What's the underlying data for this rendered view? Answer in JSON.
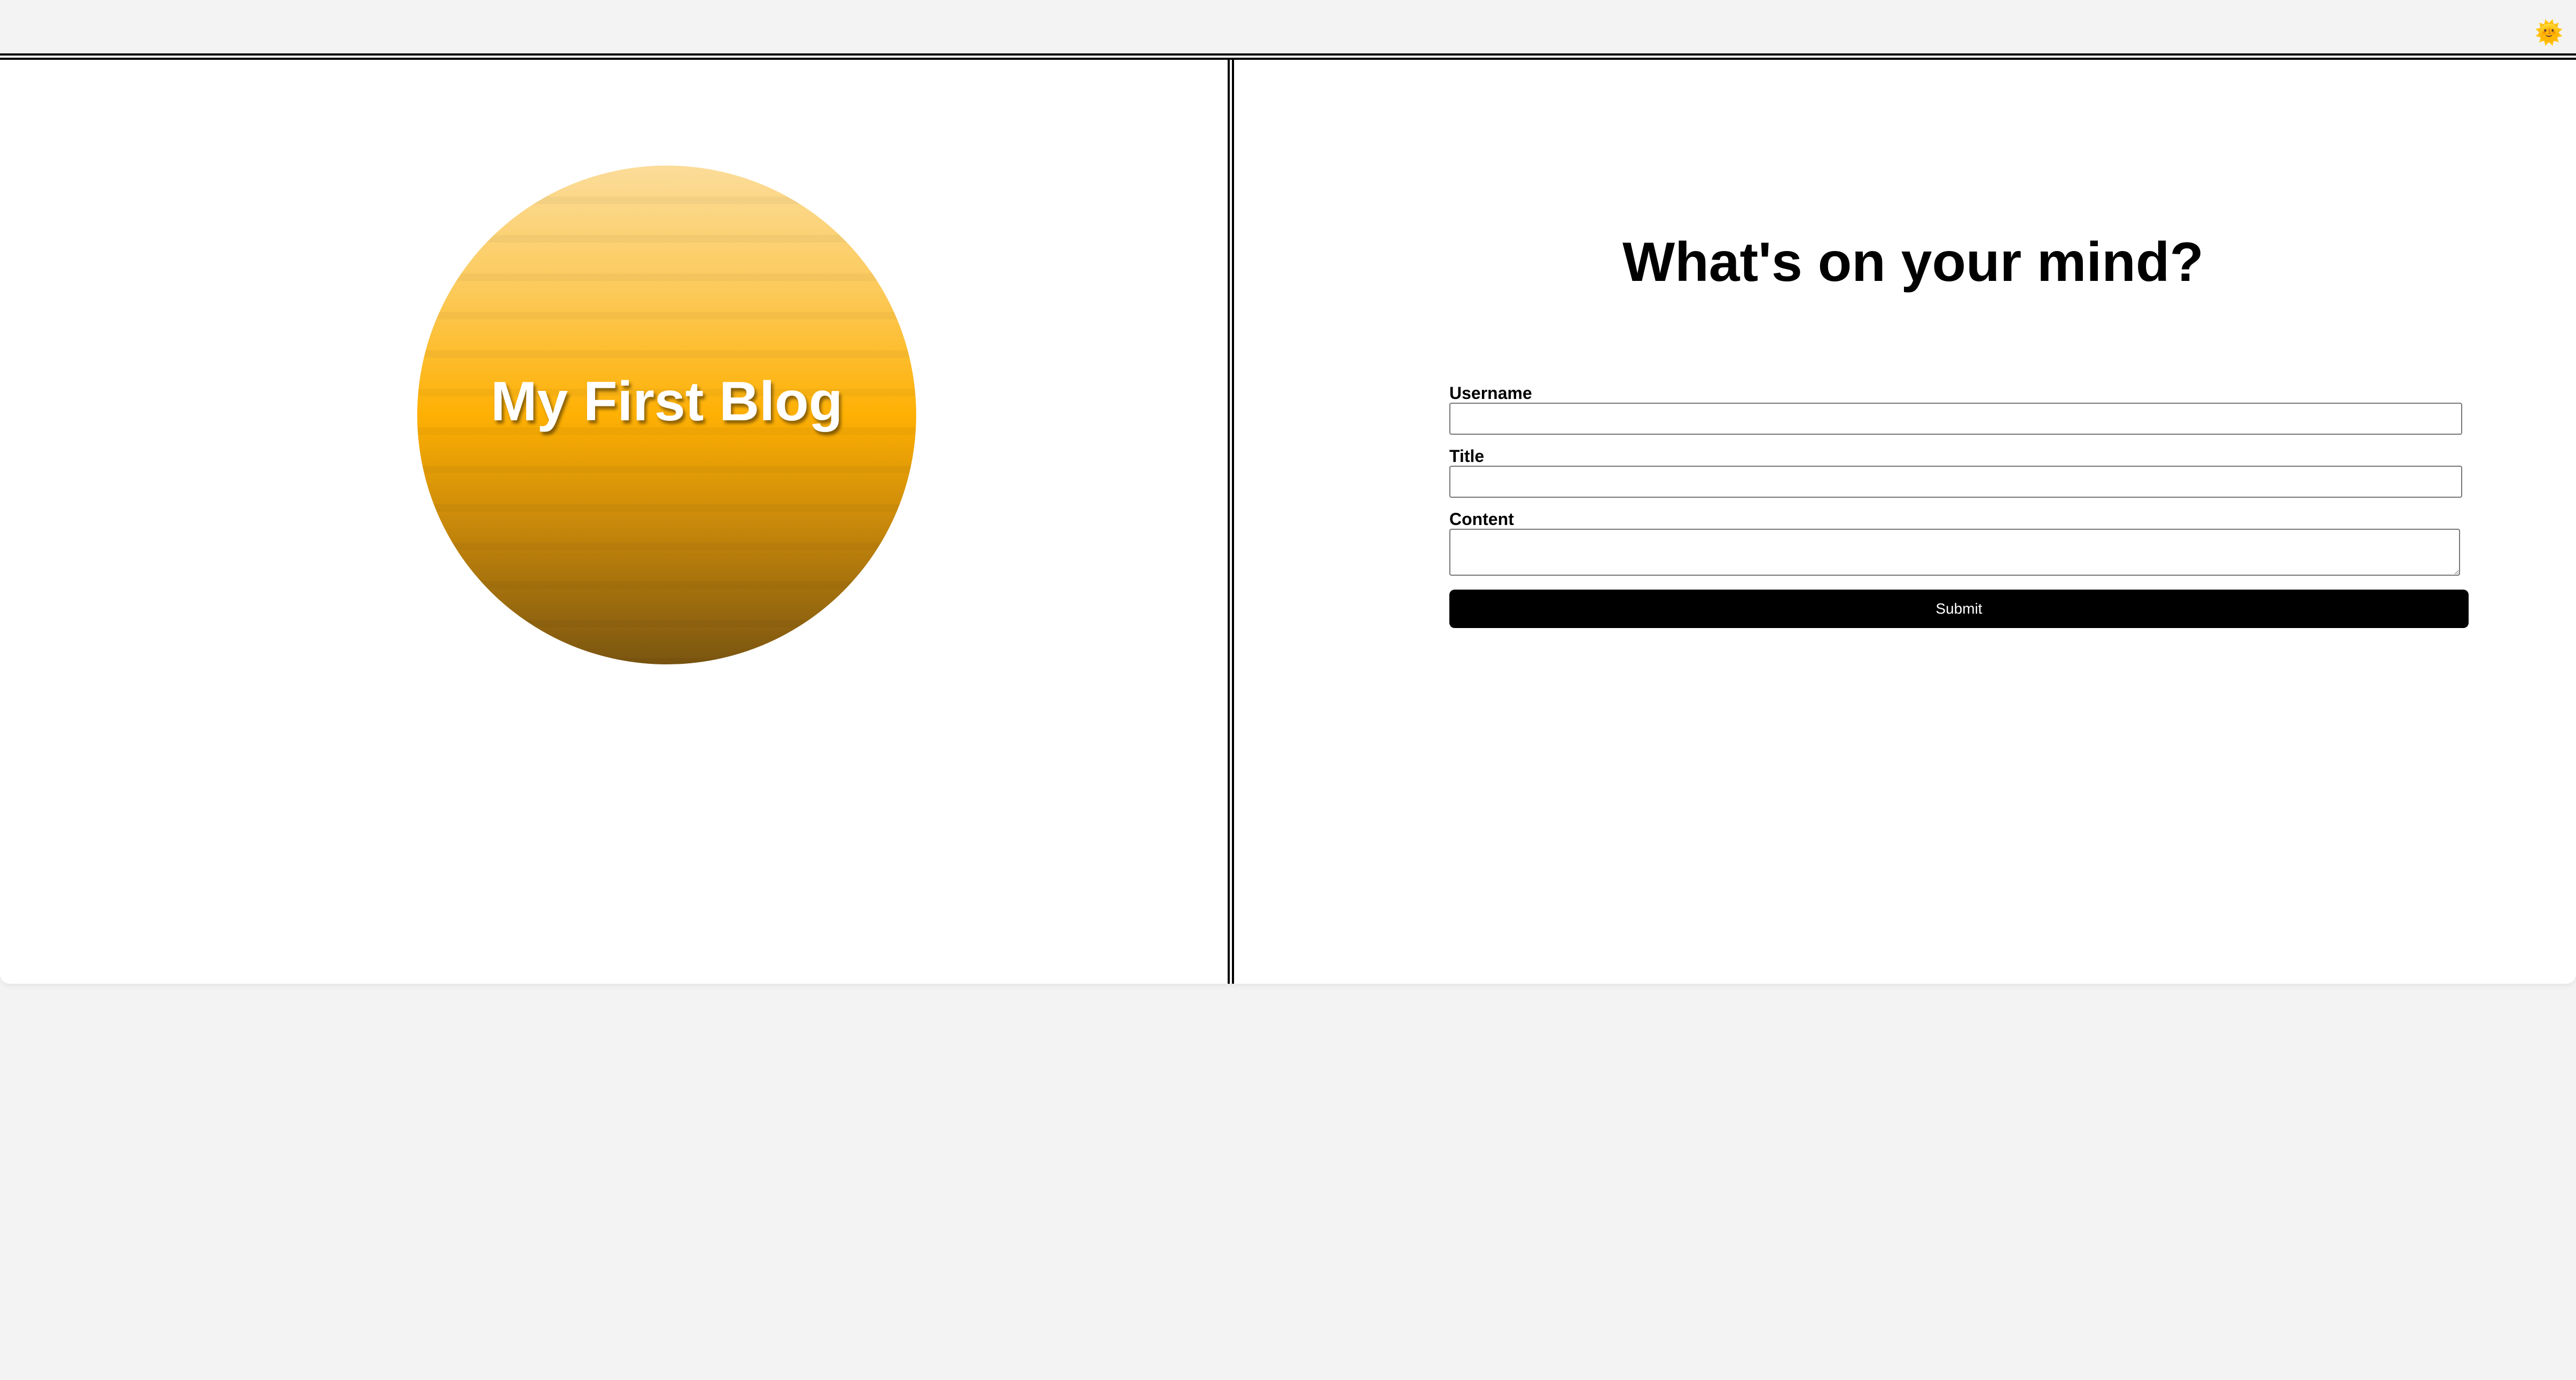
{
  "header": {
    "theme_toggle_icon": "sun-icon",
    "theme_toggle_glyph": "🌞"
  },
  "hero": {
    "title": "My First Blog",
    "colors": {
      "gradient_top": "#fbdc99",
      "gradient_middle": "#feb003",
      "gradient_bottom": "#7a5510"
    }
  },
  "form": {
    "heading": "What's on your mind?",
    "username_label": "Username",
    "username_value": "",
    "title_label": "Title",
    "title_value": "",
    "content_label": "Content",
    "content_value": "",
    "submit_label": "Submit"
  }
}
